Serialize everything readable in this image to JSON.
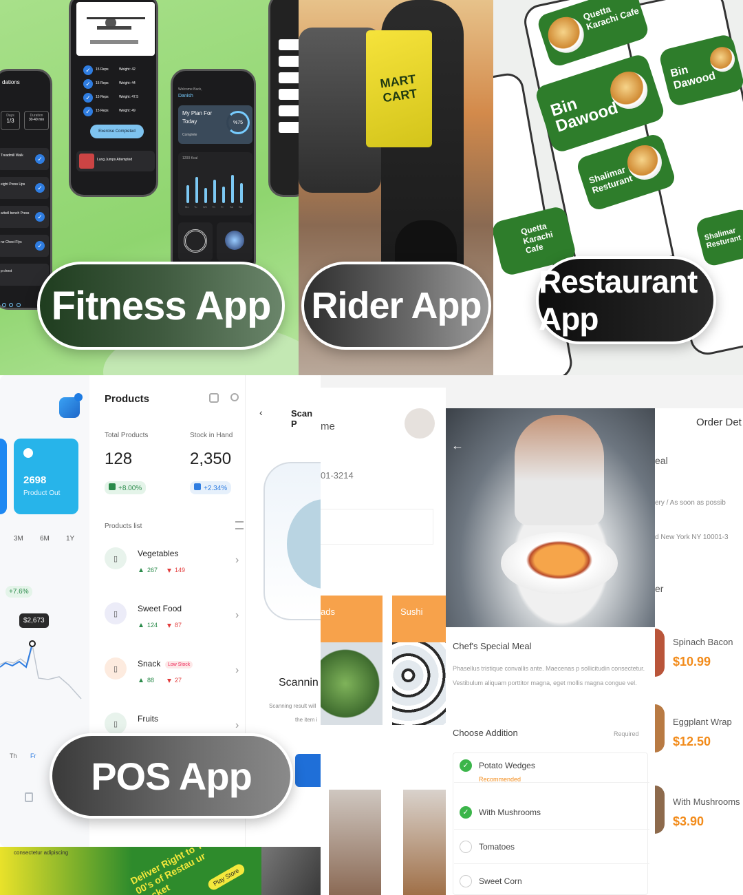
{
  "tiles": {
    "fitness": "Fitness App",
    "rider": "Rider App",
    "restaurant": "Restaurant App",
    "pos": "POS App"
  },
  "fitness": {
    "sets": [
      {
        "reps": "15 Reps",
        "weight": "Weight: 42"
      },
      {
        "reps": "15 Reps",
        "weight": "Weight: 44"
      },
      {
        "reps": "15 Reps",
        "weight": "Weight: 47.5"
      },
      {
        "reps": "15 Reps",
        "weight": "Weight: 49"
      }
    ],
    "exercise_completed": "Exercise Completed",
    "activity": "Lung Jumps Attempted",
    "left_title": "dations",
    "days_label": "Days",
    "days_value": "1/3",
    "duration_label": "Duration",
    "duration_value": "30-40 min",
    "exercises": [
      "Treadmill Walk",
      "eight Press Ups",
      "arbell bench Press",
      "ne Chest Flys",
      "p chest"
    ],
    "welcome": "Welcome Back,",
    "user": "Danish",
    "plan_title": "My Plan For Today",
    "plan_sub": "Complete",
    "plan_percent": "%75",
    "burn_label": "1200 Kcal",
    "days": [
      "Mo",
      "Tu",
      "We",
      "Th",
      "Fr",
      "Sa",
      "Su"
    ],
    "bars": [
      0.55,
      0.8,
      0.45,
      0.7,
      0.5,
      0.85,
      0.6
    ]
  },
  "rider": {
    "brand": "MART CART"
  },
  "restaurant": {
    "cards": [
      "Quetta Karachi Cafe",
      "Bin Dawood",
      "Shalimar Resturant",
      "Quetta Karachi Cafe",
      "Bin Dawood",
      "Shalimar Resturant"
    ]
  },
  "pos": {
    "title": "Products",
    "total_products_label": "Total Products",
    "total_products": "128",
    "total_change": "+8.00%",
    "stock_label": "Stock in Hand",
    "stock": "2,350",
    "stock_change": "+2.34%",
    "products_list": "Products list",
    "product_out_value": "2698",
    "product_out_label": "Product Out",
    "ranges": [
      "3M",
      "6M",
      "1Y"
    ],
    "change": "+7.6%",
    "tooltip": "$2,673",
    "weekdays": [
      "Th",
      "Fr"
    ],
    "categories": [
      {
        "name": "Vegetables",
        "up": "267",
        "down": "149",
        "badge": ""
      },
      {
        "name": "Sweet Food",
        "up": "124",
        "down": "87",
        "badge": ""
      },
      {
        "name": "Snack",
        "up": "88",
        "down": "27",
        "badge": "Low Stock"
      },
      {
        "name": "Fruits",
        "up": "",
        "down": "",
        "badge": ""
      }
    ],
    "scan_title": "Scan P",
    "scanning": "Scannin",
    "scanning_sub": "Scanning result will",
    "scanning_sub2": "the item i"
  },
  "food": {
    "name_label": "me",
    "phone_partial": "01-3214",
    "cat1": "ads",
    "cat2": "Sushi",
    "order_title": "Order Det",
    "meal_partial": "eal",
    "delivery_partial": "ery / As soon as possib",
    "address_partial": "d New York NY 10001-3",
    "er_partial": "er",
    "meal_title": "Chef's Special Meal",
    "meal_desc": "Phasellus tristique convallis ante. Maecenas p sollicitudin consectetur. Vestibulum aliquam porttitor magna, eget mollis magna congue vel.",
    "choose_addition": "Choose Addition",
    "required": "Required",
    "options": [
      {
        "name": "Potato Wedges",
        "note": "Recommended",
        "checked": true
      },
      {
        "name": "With Mushrooms",
        "note": "",
        "checked": true
      },
      {
        "name": "Tomatoes",
        "note": "",
        "checked": false
      },
      {
        "name": "Sweet Corn",
        "note": "",
        "checked": false
      }
    ],
    "dishes": [
      {
        "name": "Spinach Bacon",
        "price": "$10.99"
      },
      {
        "name": "Eggplant Wrap",
        "price": "$12.50"
      },
      {
        "name": "With Mushrooms",
        "price": "$3.90"
      }
    ]
  },
  "promo": {
    "line": "consectetur adipiscing",
    "text": "Deliver Right to Yo 00's of Restau ur pocket",
    "store": "Play Store"
  }
}
